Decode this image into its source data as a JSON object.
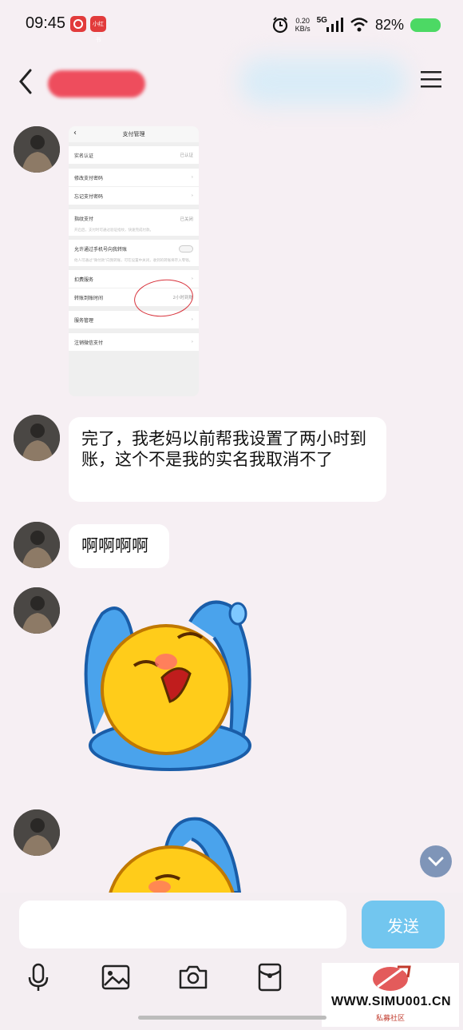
{
  "status_bar": {
    "time": "09:45",
    "app_badge_2": "小红书",
    "net_speed_value": "0.20",
    "net_speed_unit": "KB/s",
    "network": "5G",
    "battery": "82%",
    "battery_color": "#4cd964"
  },
  "header": {
    "back_icon": "chevron-left-icon",
    "menu_icon": "hamburger-menu-icon"
  },
  "payment_screenshot": {
    "title": "支付管理",
    "rows": {
      "realname": "实名认证",
      "realname_value": "已认证",
      "change_pwd": "修改支付密码",
      "forgot_pwd": "忘记支付密码",
      "fingerprint": "指纹支付",
      "fingerprint_value": "已关闭",
      "fingerprint_sub": "开启后，支付时可通过验证指纹，快速完成付款。",
      "phone_transfer": "允许通过手机号向我转账",
      "phone_transfer_sub": "他人可通过\"微付款\"向我转账，可在设置中关闭，收到的转账将存入零钱。",
      "deduct": "扣费服务",
      "transfer_time": "转账到账时间",
      "transfer_time_value": "2小时到账",
      "service_manage": "服务管理",
      "cancel_wechat_pay": "注销微信支付"
    }
  },
  "messages": [
    {
      "text": "完了，我老妈以前帮我设置了两小时到账，这个不是我的实名我取消不了"
    },
    {
      "text": "啊啊啊啊"
    }
  ],
  "input": {
    "value": "",
    "send_label": "发送"
  },
  "toolbar_icons": [
    "microphone-icon",
    "image-icon",
    "camera-icon",
    "red-packet-icon"
  ],
  "watermark": {
    "text": "WWW.SIMU001.CN",
    "sub": "私募社区"
  },
  "colors": {
    "send_button": "#72c6ef",
    "background": "#f6eff3"
  }
}
